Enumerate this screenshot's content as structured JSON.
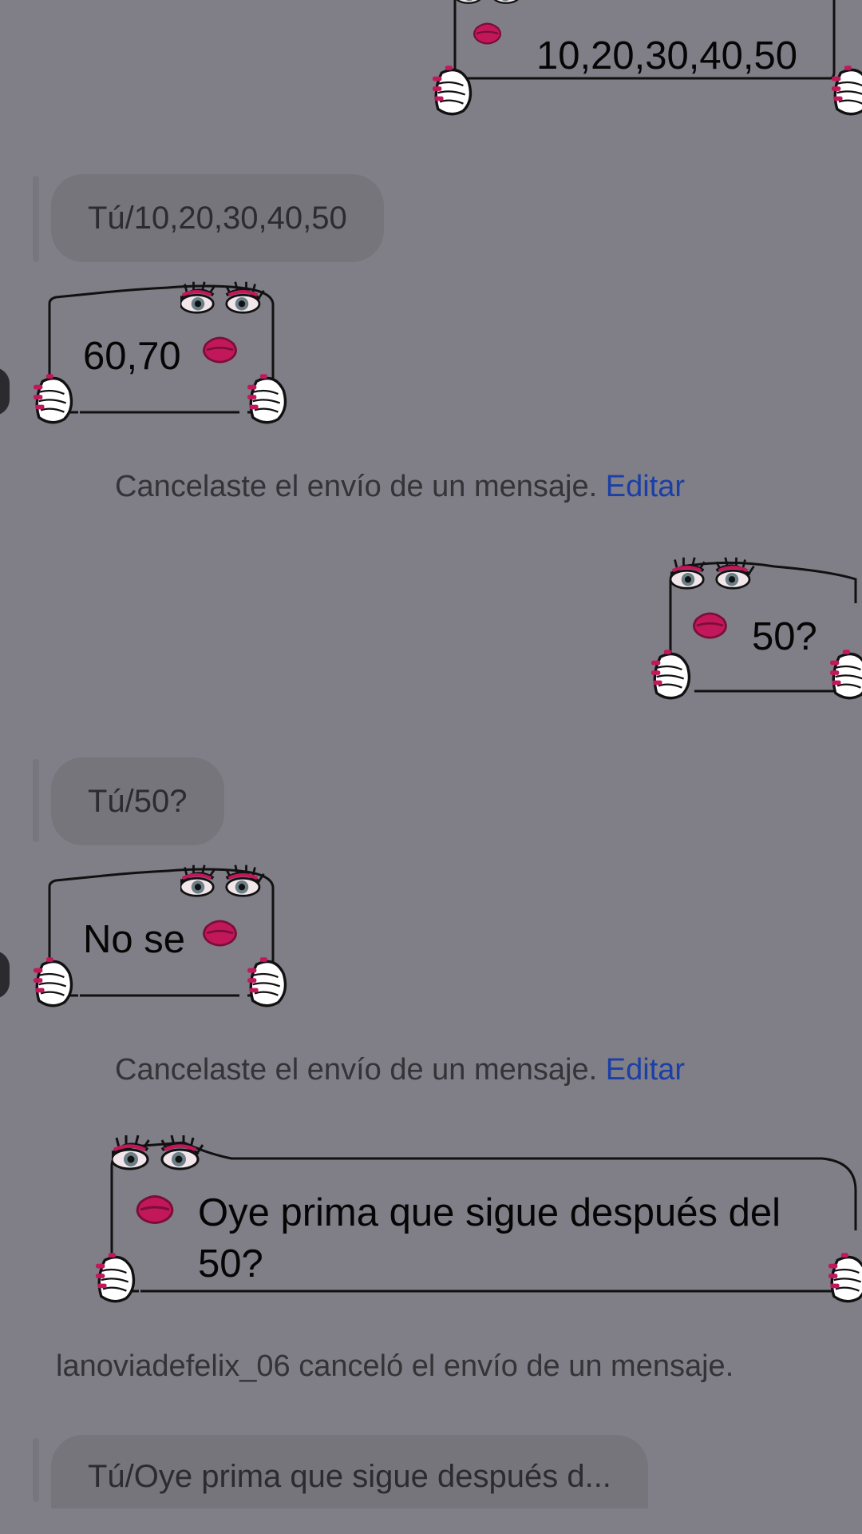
{
  "messages": {
    "sent_1": "10,20,30,40,50",
    "reply_1": "Tú/10,20,30,40,50",
    "received_1": "60,70",
    "sent_2": "50?",
    "reply_2": "Tú/50?",
    "received_2": "No se",
    "sent_3_line1": "Oye prima que sigue después del",
    "sent_3_line2": "50?",
    "reply_3": "Tú/Oye prima que sigue después d..."
  },
  "notices": {
    "cancel_self": "Cancelaste el envío de un mensaje.",
    "edit_link": "Editar",
    "cancel_other": "lanoviadefelix_06 canceló el envío de un mensaje."
  },
  "colors": {
    "background": "#807e86",
    "link": "#1a3fa6",
    "lips": "#c2185b",
    "nails": "#c2185b"
  },
  "icons": {
    "sticker_face": "cartoon-eyes-and-lips",
    "sticker_hands": "hands-with-pink-nails"
  }
}
